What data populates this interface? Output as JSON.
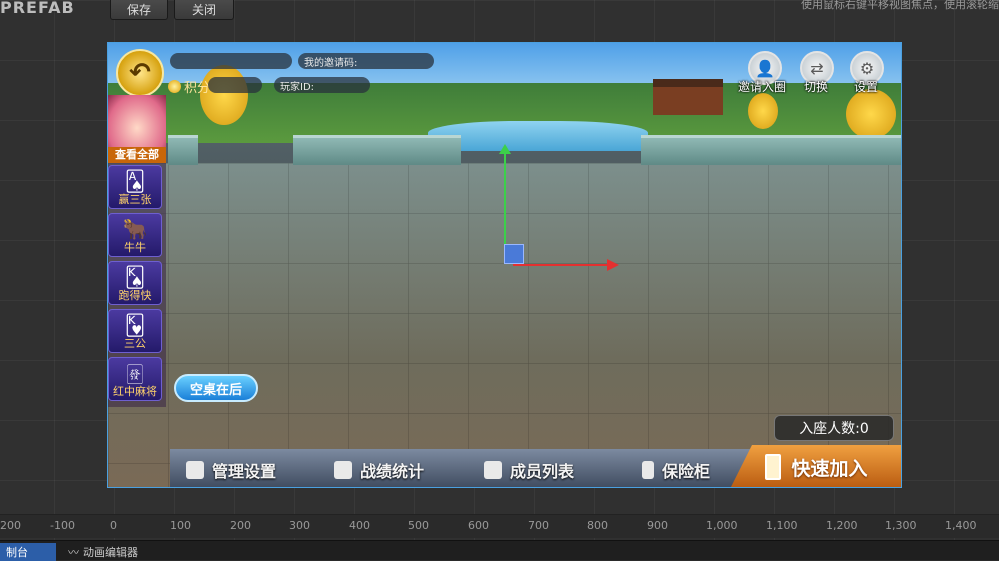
{
  "editor": {
    "title": "PREFAB",
    "save_label": "保存",
    "close_label": "关闭",
    "hint": "使用鼠标右键平移视图焦点，使用滚轮缩"
  },
  "ruler": {
    "ticks": [
      "200",
      "-100",
      "0",
      "100",
      "200",
      "300",
      "400",
      "500",
      "600",
      "700",
      "800",
      "900",
      "1,000",
      "1,100",
      "1,200",
      "1,300",
      "1,400"
    ]
  },
  "bottom_tabs": {
    "active": "制台",
    "anim": "动画编辑器"
  },
  "game": {
    "invite_code_label": "我的邀请码:",
    "player_id_label": "玩家ID:",
    "score_label": "积分",
    "top_buttons": {
      "invite": "邀请入圈",
      "switch": "切换",
      "settings": "设置"
    },
    "sidebar": {
      "view_all": "查看全部",
      "games": [
        "赢三张",
        "牛牛",
        "跑得快",
        "三公",
        "红中麻将"
      ]
    },
    "empty_table_button": "空桌在后",
    "seated_count": "入座人数:0",
    "bottom_bar": {
      "manage": "管理设置",
      "stats": "战绩统计",
      "members": "成员列表",
      "safe": "保险柜",
      "quick_join": "快速加入"
    },
    "icons": {
      "back": "back-arrow-icon",
      "invite": "add-user-icon",
      "switch": "swap-icon",
      "settings": "gear-icon"
    }
  }
}
